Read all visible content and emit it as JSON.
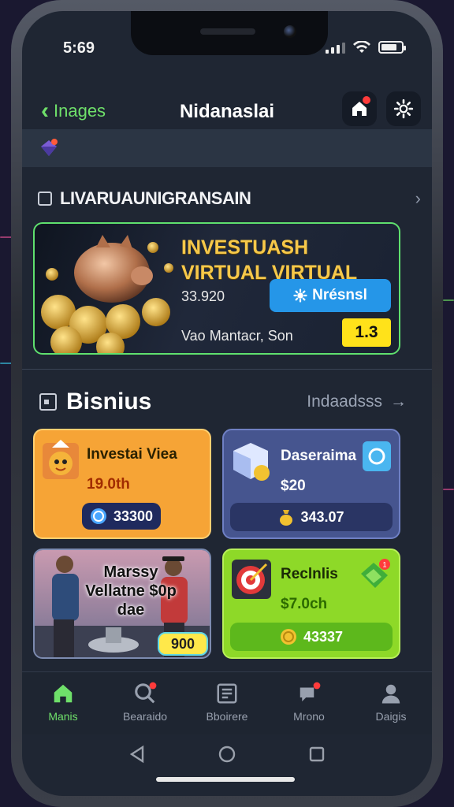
{
  "status": {
    "time": "5:69"
  },
  "header": {
    "back_label": "Inages",
    "title": "Nidanaslai"
  },
  "section": {
    "title": "LIVARUAUNIGRANSAIN"
  },
  "banner": {
    "title": "INVESTUASH VIRTUAL VIRTUAL",
    "amount": "33.920",
    "cta_label": "Nrésnsl",
    "subtitle": "Vao Mantacr, Son",
    "badge": "1.3"
  },
  "business": {
    "title": "Bisnius",
    "more_label": "Indaadsss",
    "cards": [
      {
        "title": "Investai Viea",
        "price": "19.0th",
        "pill": "33300"
      },
      {
        "title": "Daseraima",
        "price": "$20",
        "pill": "343.07"
      },
      {
        "title": "Marssy Vellatne $0p dae",
        "pill": "900"
      },
      {
        "title": "Reclnlis",
        "price": "$7.0ch",
        "pill": "43337"
      }
    ]
  },
  "nav": {
    "items": [
      {
        "label": "Manis",
        "icon": "home-icon"
      },
      {
        "label": "Bearaido",
        "icon": "search-icon"
      },
      {
        "label": "Bboirere",
        "icon": "list-icon"
      },
      {
        "label": "Mrono",
        "icon": "chat-icon"
      },
      {
        "label": "Daigis",
        "icon": "user-icon"
      }
    ]
  },
  "colors": {
    "accent_green": "#6fe06a",
    "banner_gold": "#f6c84a",
    "cta_blue": "#2596e8",
    "badge_yellow": "#ffe21a",
    "card_orange": "#f6a436",
    "card_indigo": "#46558f",
    "card_lime": "#8ed928"
  }
}
